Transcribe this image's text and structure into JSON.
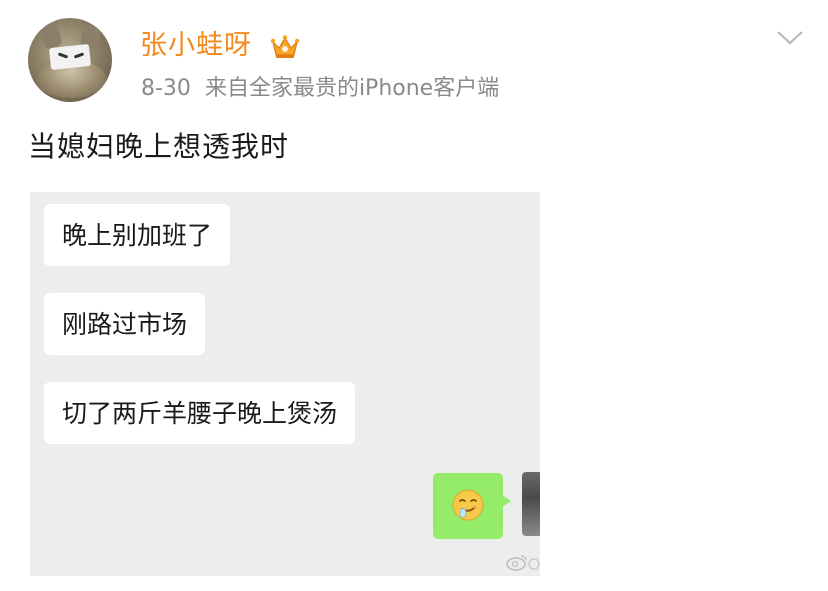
{
  "post": {
    "username": "张小蛙呀",
    "date": "8-30",
    "source": "来自全家最贵的iPhone客户端",
    "text": "当媳妇晚上想透我时",
    "icons": {
      "vip": "crown-vip-icon",
      "menu": "chevron-down-icon",
      "emoji": "drooling-face-emoji-icon",
      "watermark": "weibo-watermark-icon"
    },
    "colors": {
      "username": "#f28a1e",
      "meta": "#8a8a8a",
      "chat_background": "#ededed",
      "sent_bubble": "#95ec69"
    }
  },
  "chat": {
    "messages": [
      "晚上别加班了",
      "刚路过市场",
      "切了两斤羊腰子晚上煲汤"
    ]
  }
}
